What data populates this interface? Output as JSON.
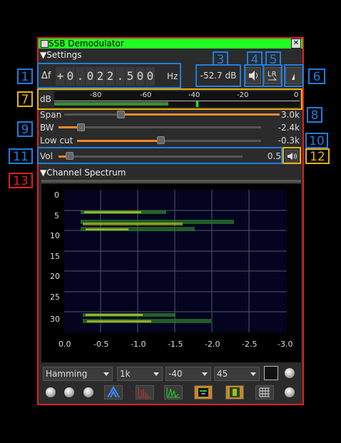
{
  "window": {
    "title": "SSB Demodulator",
    "close_glyph": "✕"
  },
  "settings": {
    "header": "Settings",
    "delta_f_label": "Δf",
    "freq_digits": [
      "+",
      "0",
      ".",
      "0",
      "2",
      "2",
      ".",
      "5",
      "0",
      "0"
    ],
    "freq_unit": "Hz",
    "channel_power": "-52.7  dB",
    "meter_label": "dB",
    "meter_ticks": [
      "-80",
      "-60",
      "-40",
      "-20",
      "0"
    ],
    "meter_level": 0.8,
    "span": {
      "label": "Span",
      "value": "3.0k",
      "fraction": 0.27
    },
    "bw": {
      "label": "BW",
      "value": "-2.4k",
      "fraction": 0.1
    },
    "low_cut": {
      "label": "Low cut",
      "value": "-0.3k",
      "fraction": 0.45
    },
    "vol": {
      "label": "Vol",
      "value": "0.5",
      "fraction": 0.05
    }
  },
  "spectrum": {
    "header": "Channel Spectrum",
    "y_ticks": [
      "0",
      "5",
      "10",
      "15",
      "20",
      "25",
      "30"
    ],
    "x_ticks": [
      "0.0",
      "-0.5",
      "-1.0",
      "-1.5",
      "-2.0",
      "-2.5",
      "-3.0"
    ],
    "window_fn": "Hamming",
    "fft_size": "1k",
    "ref_level": "-40",
    "range": "45"
  },
  "callouts": [
    "1",
    "2",
    "3",
    "4",
    "5",
    "6",
    "7",
    "8",
    "9",
    "10",
    "11",
    "12",
    "13"
  ],
  "colors": {
    "accent_bar": "#f08a2c",
    "title_bar": "#22ff22",
    "callout_blue": "#1e7fe0",
    "callout_yellow": "#e8b20c",
    "callout_red": "#e0201e"
  }
}
